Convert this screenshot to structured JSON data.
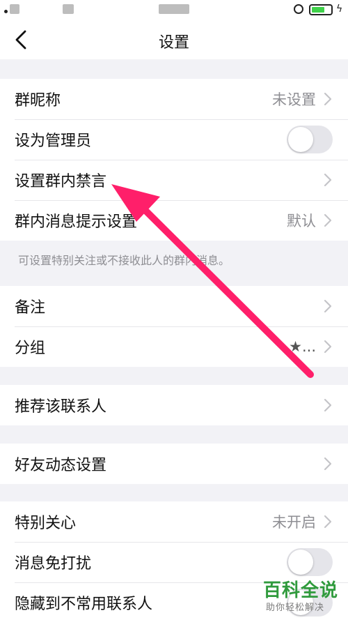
{
  "header": {
    "title": "设置"
  },
  "group1": {
    "nickname": {
      "label": "群昵称",
      "value": "未设置"
    },
    "admin": {
      "label": "设为管理员"
    },
    "mute": {
      "label": "设置群内禁言"
    },
    "notify": {
      "label": "群内消息提示设置",
      "value": "默认"
    }
  },
  "note": "可设置特别关注或不接收此人的群内消息。",
  "group2": {
    "remark": {
      "label": "备注"
    },
    "group": {
      "label": "分组",
      "value": "★..."
    }
  },
  "group3": {
    "recommend": {
      "label": "推荐该联系人"
    }
  },
  "group4": {
    "feed": {
      "label": "好友动态设置"
    }
  },
  "group5": {
    "special": {
      "label": "特别关心",
      "value": "未开启"
    },
    "dnd": {
      "label": "消息免打扰"
    },
    "hide": {
      "label": "隐藏到不常用联系人"
    }
  },
  "watermark": {
    "title": "百科全说",
    "subtitle": "助你轻松解决"
  },
  "colors": {
    "arrow": "#ff1f6a",
    "battery": "#3fd14a",
    "watermark": "#2f9a3c"
  }
}
